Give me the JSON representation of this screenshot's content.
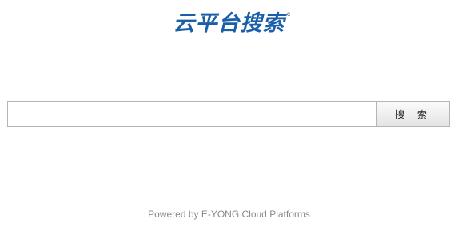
{
  "logo": {
    "text": "云平台搜索",
    "mark": "e"
  },
  "search": {
    "input_value": "",
    "button_label": "搜 索"
  },
  "footer": {
    "text": "Powered by E-YONG Cloud Platforms"
  },
  "colors": {
    "brand": "#1a5fa8",
    "footer_text": "#8a8a8a",
    "border": "#b5b5b5"
  }
}
